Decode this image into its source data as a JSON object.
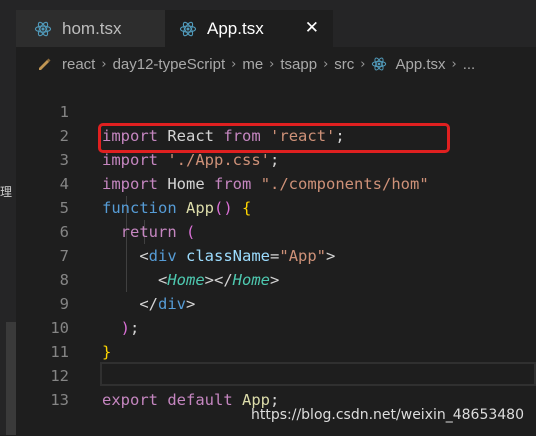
{
  "tabs": [
    {
      "label": "hom.tsx",
      "active": false
    },
    {
      "label": "App.tsx",
      "active": true,
      "close_glyph": "✕"
    }
  ],
  "breadcrumb": [
    "react",
    "day12-typeScript",
    "me",
    "tsapp",
    "src",
    "App.tsx",
    "..."
  ],
  "left_panel": {
    "glyph": "理"
  },
  "code_lines": [
    {
      "n": "1"
    },
    {
      "n": "2"
    },
    {
      "n": "3"
    },
    {
      "n": "4"
    },
    {
      "n": "5"
    },
    {
      "n": "6"
    },
    {
      "n": "7"
    },
    {
      "n": "8"
    },
    {
      "n": "9"
    },
    {
      "n": "10"
    },
    {
      "n": "11"
    },
    {
      "n": "12"
    },
    {
      "n": "13"
    }
  ],
  "tokens": {
    "l1": {
      "import": "import",
      "name": "React",
      "from": "from",
      "str": "'react'",
      "semi": ";"
    },
    "l2": {
      "import": "import",
      "str": "'./App.css'",
      "semi": ";"
    },
    "l3": {
      "import": "import",
      "name": "Home",
      "from": "from",
      "str": "\"./components/hom\""
    },
    "l4": {
      "function": "function",
      "name": "App",
      "parens": "()",
      "brace": "{"
    },
    "l5": {
      "return": "return",
      "paren": "("
    },
    "l6": {
      "lt": "<",
      "tag": "div",
      "attr": "className",
      "eq": "=",
      "str": "\"App\"",
      "gt": ">"
    },
    "l7": {
      "lt": "<",
      "comp": "Home",
      "mid": "></",
      "comp2": "Home",
      "gt": ">"
    },
    "l8": {
      "lt": "</",
      "tag": "div",
      "gt": ">"
    },
    "l9": {
      "paren": ")",
      "semi": ";"
    },
    "l10": {
      "brace": "}"
    },
    "l12": {
      "export": "export",
      "default": "default",
      "name": "App",
      "semi": ";"
    }
  },
  "watermark": "https://blog.csdn.net/weixin_48653480",
  "colors": {
    "highlight_box": "#e02020",
    "editor_bg": "#1e1e1e"
  }
}
